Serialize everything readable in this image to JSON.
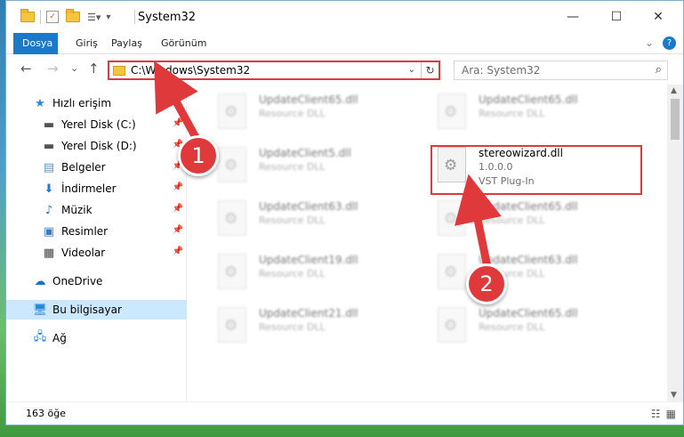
{
  "window": {
    "title": "System32",
    "controls": {
      "minimize": "—",
      "maximize": "☐",
      "close": "✕"
    }
  },
  "ribbon": {
    "tabs": [
      "Dosya",
      "Giriş",
      "Paylaş",
      "Görünüm"
    ],
    "expand_icon": "chevron-down-icon",
    "help_label": "?"
  },
  "navigation": {
    "back": "←",
    "forward": "→",
    "recent": "⌄",
    "up": "↑",
    "address": "C:\\Windows\\System32",
    "dropdown": "⌄",
    "refresh": "↻",
    "search_placeholder": "Ara: System32"
  },
  "sidebar": {
    "items": [
      {
        "label": "Hızlı erişim",
        "icon": "star-icon"
      },
      {
        "label": "Yerel Disk (C:)",
        "icon": "drive-icon",
        "pinned": true
      },
      {
        "label": "Yerel Disk (D:)",
        "icon": "drive-icon",
        "pinned": true
      },
      {
        "label": "Belgeler",
        "icon": "documents-icon",
        "pinned": true
      },
      {
        "label": "İndirmeler",
        "icon": "download-icon",
        "pinned": true
      },
      {
        "label": "Müzik",
        "icon": "music-icon",
        "pinned": true
      },
      {
        "label": "Resimler",
        "icon": "pictures-icon",
        "pinned": true
      },
      {
        "label": "Videolar",
        "icon": "videos-icon",
        "pinned": true
      },
      {
        "label": "OneDrive",
        "icon": "cloud-icon"
      },
      {
        "label": "Bu bilgisayar",
        "icon": "computer-icon",
        "selected": true
      },
      {
        "label": "Ağ",
        "icon": "network-icon"
      }
    ]
  },
  "files": {
    "left_column": [
      {
        "name": "UpdateClient65.dll",
        "type": "Resource DLL"
      },
      {
        "name": "UpdateClient5.dll",
        "type": "Resource DLL"
      },
      {
        "name": "UpdateClient63.dll",
        "type": "Resource DLL"
      },
      {
        "name": "UpdateClient19.dll",
        "type": "Resource DLL"
      },
      {
        "name": "UpdateClient21.dll",
        "type": "Resource DLL"
      }
    ],
    "right_column": [
      {
        "name": "UpdateClient65.dll",
        "type": "Resource DLL"
      },
      {
        "name": "stereowizard.dll",
        "version": "1.0.0.0",
        "type": "VST Plug-In"
      },
      {
        "name": "UpdateClient65.dll",
        "type": "Resource DLL"
      },
      {
        "name": "UpdateClient63.dll",
        "type": "Resource DLL"
      },
      {
        "name": "UpdateClient65.dll",
        "type": "Resource DLL"
      }
    ]
  },
  "status": {
    "item_count": "163 öğe"
  },
  "annotations": {
    "step1": "1",
    "step2": "2",
    "color": "#e0393b"
  }
}
